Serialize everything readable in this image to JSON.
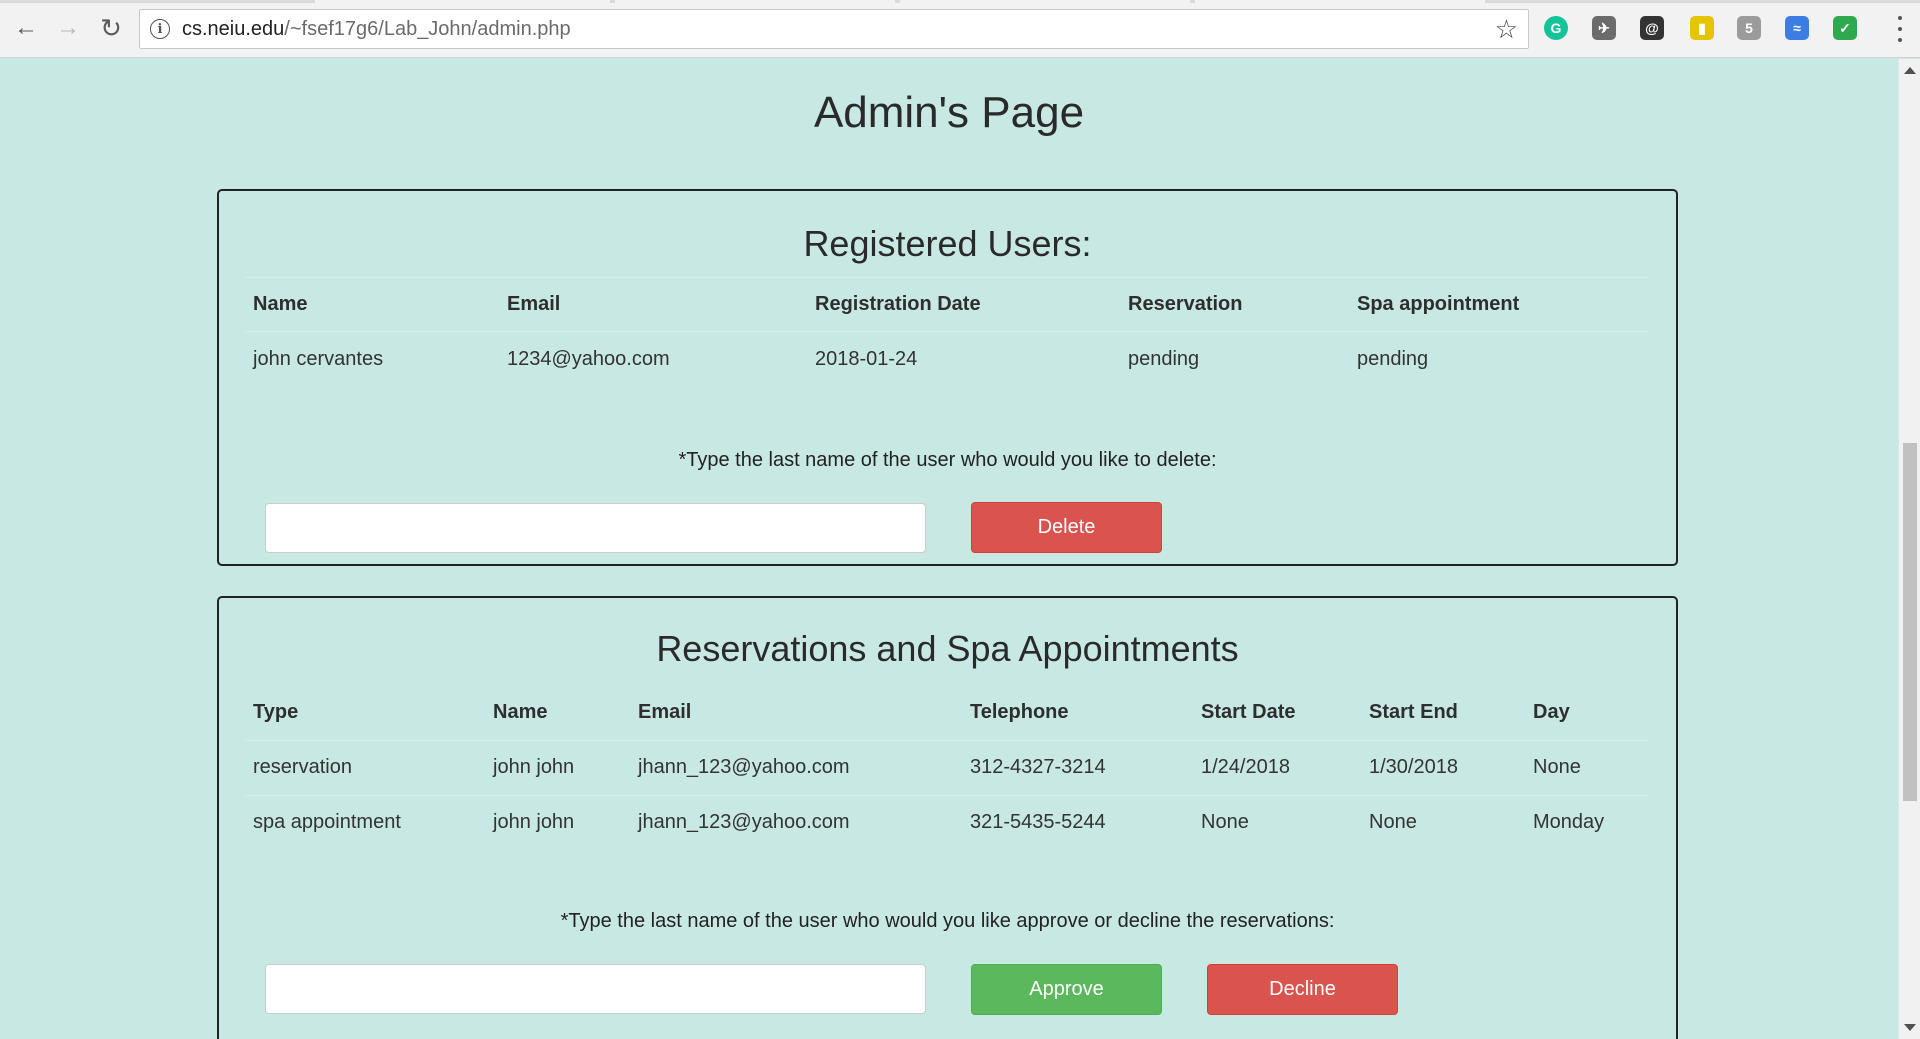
{
  "browser": {
    "url_domain": "cs.neiu.edu",
    "url_path": "/~fsef17g6/Lab_John/admin.php",
    "extensions": [
      {
        "name": "grammarly-icon",
        "color": "#15c39a",
        "glyph": "G"
      },
      {
        "name": "extension-badge-icon",
        "color": "#6b6b6b",
        "glyph": "✈"
      },
      {
        "name": "privacy-extension-icon",
        "color": "#333333",
        "glyph": "@"
      },
      {
        "name": "ebay-extension-icon",
        "color": "#e5c400",
        "glyph": "▮"
      },
      {
        "name": "html5-extension-icon",
        "color": "#9b9b9b",
        "glyph": "5"
      },
      {
        "name": "sync-extension-icon",
        "color": "#3b7de0",
        "glyph": "≈"
      },
      {
        "name": "shield-extension-icon",
        "color": "#2fa84f",
        "glyph": "✓"
      }
    ]
  },
  "page": {
    "title": "Admin's Page"
  },
  "registered_users": {
    "title": "Registered Users:",
    "columns": [
      "Name",
      "Email",
      "Registration Date",
      "Reservation",
      "Spa appointment"
    ],
    "rows": [
      [
        "john cervantes",
        "1234@yahoo.com",
        "2018-01-24",
        "pending",
        "pending"
      ]
    ],
    "prompt": "*Type the last name of the user who would you like to delete:",
    "input_value": "",
    "delete_label": "Delete"
  },
  "reservations": {
    "title": "Reservations and Spa Appointments",
    "columns": [
      "Type",
      "Name",
      "Email",
      "Telephone",
      "Start Date",
      "Start End",
      "Day"
    ],
    "rows": [
      [
        "reservation",
        "john john",
        "jhann_123@yahoo.com",
        "312-4327-3214",
        "1/24/2018",
        "1/30/2018",
        "None"
      ],
      [
        "spa appointment",
        "john john",
        "jhann_123@yahoo.com",
        "321-5435-5244",
        "None",
        "None",
        "Monday"
      ]
    ],
    "prompt": "*Type the last name of the user who would you like approve or decline the reservations:",
    "input_value": "",
    "approve_label": "Approve",
    "decline_label": "Decline"
  },
  "colors": {
    "page_background": "#c8e9e3",
    "danger": "#d9534f",
    "success": "#5cb85c"
  }
}
